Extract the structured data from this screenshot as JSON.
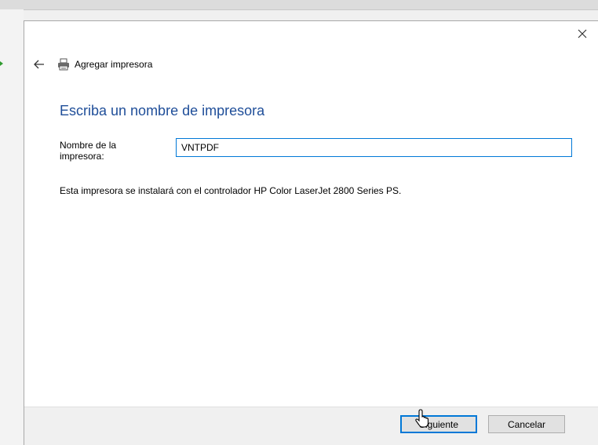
{
  "dialog": {
    "window_title": "Agregar impresora",
    "page_title": "Escriba un nombre de impresora",
    "field_label": "Nombre de la impresora:",
    "printer_name_value": "VNTPDF",
    "driver_text": "Esta impresora se instalará con el controlador HP Color LaserJet 2800 Series PS.",
    "next_label": "Siguiente",
    "cancel_label": "Cancelar"
  },
  "icons": {
    "close": "close-icon",
    "back": "arrow-left-icon",
    "printer": "printer-icon",
    "cursor": "mouse-pointer-icon"
  },
  "colors": {
    "title_blue": "#1f4e99",
    "focus_blue": "#0078d7",
    "footer_gray": "#f0f0f0"
  }
}
